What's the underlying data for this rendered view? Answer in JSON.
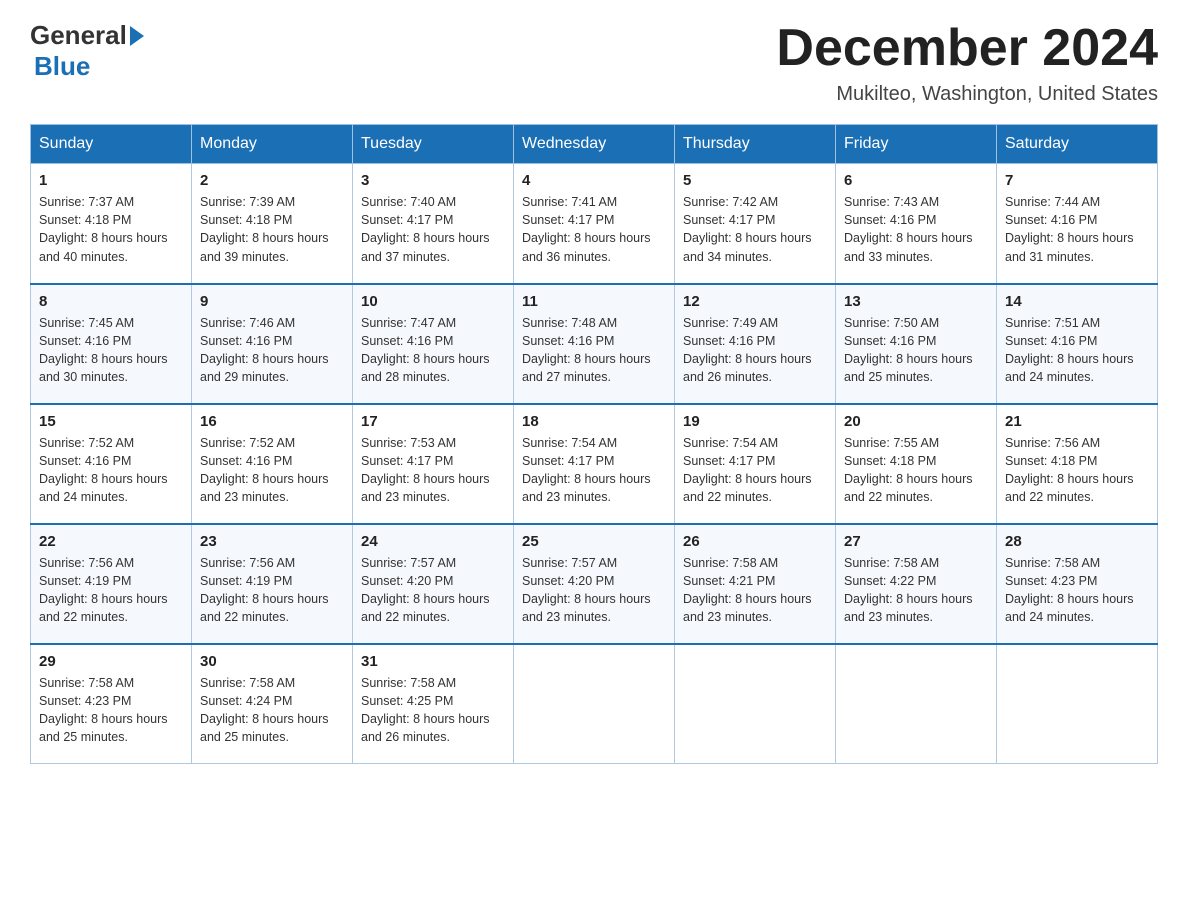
{
  "header": {
    "logo_general": "General",
    "logo_blue": "Blue",
    "month_title": "December 2024",
    "location": "Mukilteo, Washington, United States"
  },
  "days_of_week": [
    "Sunday",
    "Monday",
    "Tuesday",
    "Wednesday",
    "Thursday",
    "Friday",
    "Saturday"
  ],
  "weeks": [
    [
      {
        "day": "1",
        "sunrise": "7:37 AM",
        "sunset": "4:18 PM",
        "daylight": "8 hours and 40 minutes."
      },
      {
        "day": "2",
        "sunrise": "7:39 AM",
        "sunset": "4:18 PM",
        "daylight": "8 hours and 39 minutes."
      },
      {
        "day": "3",
        "sunrise": "7:40 AM",
        "sunset": "4:17 PM",
        "daylight": "8 hours and 37 minutes."
      },
      {
        "day": "4",
        "sunrise": "7:41 AM",
        "sunset": "4:17 PM",
        "daylight": "8 hours and 36 minutes."
      },
      {
        "day": "5",
        "sunrise": "7:42 AM",
        "sunset": "4:17 PM",
        "daylight": "8 hours and 34 minutes."
      },
      {
        "day": "6",
        "sunrise": "7:43 AM",
        "sunset": "4:16 PM",
        "daylight": "8 hours and 33 minutes."
      },
      {
        "day": "7",
        "sunrise": "7:44 AM",
        "sunset": "4:16 PM",
        "daylight": "8 hours and 31 minutes."
      }
    ],
    [
      {
        "day": "8",
        "sunrise": "7:45 AM",
        "sunset": "4:16 PM",
        "daylight": "8 hours and 30 minutes."
      },
      {
        "day": "9",
        "sunrise": "7:46 AM",
        "sunset": "4:16 PM",
        "daylight": "8 hours and 29 minutes."
      },
      {
        "day": "10",
        "sunrise": "7:47 AM",
        "sunset": "4:16 PM",
        "daylight": "8 hours and 28 minutes."
      },
      {
        "day": "11",
        "sunrise": "7:48 AM",
        "sunset": "4:16 PM",
        "daylight": "8 hours and 27 minutes."
      },
      {
        "day": "12",
        "sunrise": "7:49 AM",
        "sunset": "4:16 PM",
        "daylight": "8 hours and 26 minutes."
      },
      {
        "day": "13",
        "sunrise": "7:50 AM",
        "sunset": "4:16 PM",
        "daylight": "8 hours and 25 minutes."
      },
      {
        "day": "14",
        "sunrise": "7:51 AM",
        "sunset": "4:16 PM",
        "daylight": "8 hours and 24 minutes."
      }
    ],
    [
      {
        "day": "15",
        "sunrise": "7:52 AM",
        "sunset": "4:16 PM",
        "daylight": "8 hours and 24 minutes."
      },
      {
        "day": "16",
        "sunrise": "7:52 AM",
        "sunset": "4:16 PM",
        "daylight": "8 hours and 23 minutes."
      },
      {
        "day": "17",
        "sunrise": "7:53 AM",
        "sunset": "4:17 PM",
        "daylight": "8 hours and 23 minutes."
      },
      {
        "day": "18",
        "sunrise": "7:54 AM",
        "sunset": "4:17 PM",
        "daylight": "8 hours and 23 minutes."
      },
      {
        "day": "19",
        "sunrise": "7:54 AM",
        "sunset": "4:17 PM",
        "daylight": "8 hours and 22 minutes."
      },
      {
        "day": "20",
        "sunrise": "7:55 AM",
        "sunset": "4:18 PM",
        "daylight": "8 hours and 22 minutes."
      },
      {
        "day": "21",
        "sunrise": "7:56 AM",
        "sunset": "4:18 PM",
        "daylight": "8 hours and 22 minutes."
      }
    ],
    [
      {
        "day": "22",
        "sunrise": "7:56 AM",
        "sunset": "4:19 PM",
        "daylight": "8 hours and 22 minutes."
      },
      {
        "day": "23",
        "sunrise": "7:56 AM",
        "sunset": "4:19 PM",
        "daylight": "8 hours and 22 minutes."
      },
      {
        "day": "24",
        "sunrise": "7:57 AM",
        "sunset": "4:20 PM",
        "daylight": "8 hours and 22 minutes."
      },
      {
        "day": "25",
        "sunrise": "7:57 AM",
        "sunset": "4:20 PM",
        "daylight": "8 hours and 23 minutes."
      },
      {
        "day": "26",
        "sunrise": "7:58 AM",
        "sunset": "4:21 PM",
        "daylight": "8 hours and 23 minutes."
      },
      {
        "day": "27",
        "sunrise": "7:58 AM",
        "sunset": "4:22 PM",
        "daylight": "8 hours and 23 minutes."
      },
      {
        "day": "28",
        "sunrise": "7:58 AM",
        "sunset": "4:23 PM",
        "daylight": "8 hours and 24 minutes."
      }
    ],
    [
      {
        "day": "29",
        "sunrise": "7:58 AM",
        "sunset": "4:23 PM",
        "daylight": "8 hours and 25 minutes."
      },
      {
        "day": "30",
        "sunrise": "7:58 AM",
        "sunset": "4:24 PM",
        "daylight": "8 hours and 25 minutes."
      },
      {
        "day": "31",
        "sunrise": "7:58 AM",
        "sunset": "4:25 PM",
        "daylight": "8 hours and 26 minutes."
      },
      null,
      null,
      null,
      null
    ]
  ]
}
